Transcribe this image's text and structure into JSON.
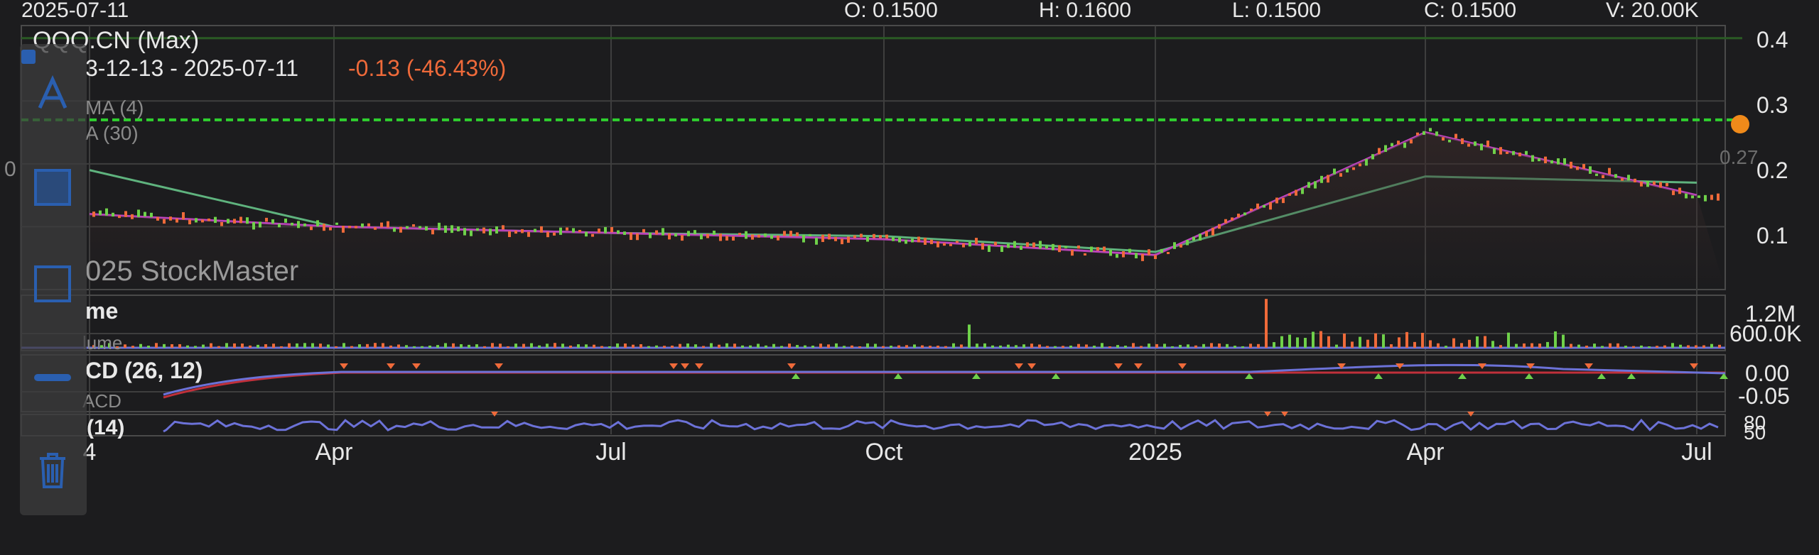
{
  "header": {
    "date": "2025-07-11",
    "open": "O: 0.1500",
    "high": "H: 0.1600",
    "low": "L: 0.1500",
    "close": "C: 0.1500",
    "volume": "V: 20.00K"
  },
  "symbol": {
    "title": "QQQ.CN (Max)",
    "range": "3-12-13 - 2025-07-11",
    "change": "-0.13 (-46.43%)",
    "ma4": "MA (4)",
    "ma30": "A (30)",
    "watermark": "025 StockMaster",
    "left_partial": "0"
  },
  "price_axis": {
    "t04": "0.4",
    "t03": "0.3",
    "t02": "0.2",
    "t01": "0.1",
    "last": "0.27"
  },
  "volume_panel": {
    "title": "me",
    "sub": "lume",
    "t1": "1.2M",
    "t2": "600.0K"
  },
  "macd_panel": {
    "title": "CD (26, 12)",
    "sub": "ACD",
    "t1": "0.00",
    "t2": "-0.05"
  },
  "rsi_panel": {
    "title": "(14)",
    "t1": "80",
    "t2": "50"
  },
  "x_axis": [
    "4",
    "Apr",
    "Jul",
    "Oct",
    "2025",
    "Apr",
    "Jul"
  ],
  "toolbar": {
    "items": [
      "text-tool",
      "rect-fill-tool",
      "rect-outline-tool",
      "line-tool",
      "delete-tool"
    ],
    "accent": "#2a5fb0"
  },
  "colors": {
    "ma4": "#c546c6",
    "ma30": "#5fb37e",
    "rsi": "#6c72d8",
    "macd": "#6c72d8",
    "signal": "#c0303b",
    "up": "#6fd14a",
    "down": "#ef6a3a",
    "dashed": "#2fd12f",
    "badge": "#f08a1a"
  },
  "chart_data": {
    "type": "line",
    "x": [
      "2024-01",
      "2024-04",
      "2024-07",
      "2024-10",
      "2025-01",
      "2025-04",
      "2025-07"
    ],
    "series": [
      {
        "name": "MA (4)",
        "values": [
          0.12,
          0.1,
          0.09,
          0.08,
          0.055,
          0.25,
          0.15
        ]
      },
      {
        "name": "A (30)",
        "values": [
          0.19,
          0.1,
          0.09,
          0.085,
          0.06,
          0.18,
          0.17
        ]
      }
    ],
    "ylim": [
      0.0,
      0.42
    ],
    "levels": [
      0.27,
      0.4
    ]
  }
}
